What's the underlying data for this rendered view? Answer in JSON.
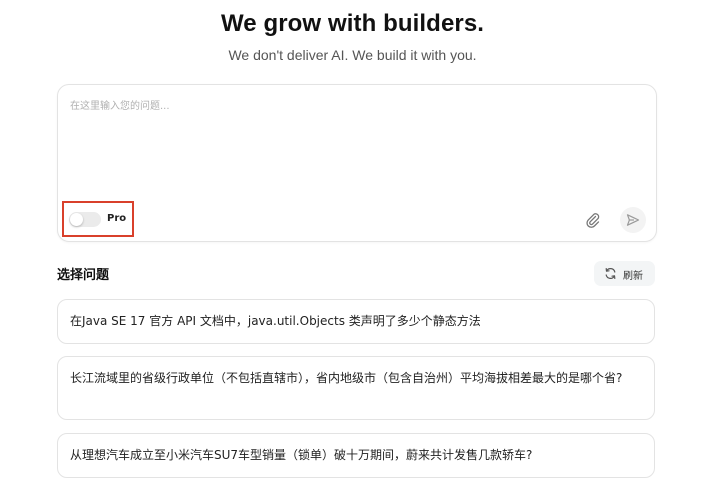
{
  "hero": {
    "title": "We grow with builders.",
    "subtitle": "We don't deliver AI. We build it with you."
  },
  "composer": {
    "placeholder": "在这里输入您的问题...",
    "pro_label": "Pro",
    "pro_enabled": false,
    "attach_icon": "paperclip-icon",
    "send_icon": "send-icon"
  },
  "questions_section": {
    "title": "选择问题",
    "refresh_label": "刷新",
    "refresh_icon": "refresh-icon",
    "items": [
      {
        "text": "在Java SE 17 官方 API 文档中，java.util.Objects 类声明了多少个静态方法"
      },
      {
        "text": "长江流域里的省级行政单位（不包括直辖市），省内地级市（包含自治州）平均海拔相差最大的是哪个省?"
      },
      {
        "text": "从理想汽车成立至小米汽车SU7车型销量（锁单）破十万期间，蔚来共计发售几款轿车?"
      }
    ]
  },
  "colors": {
    "highlight_border": "#d9402b",
    "card_border": "#e3e3e3",
    "refresh_bg": "#f3f5f6"
  }
}
